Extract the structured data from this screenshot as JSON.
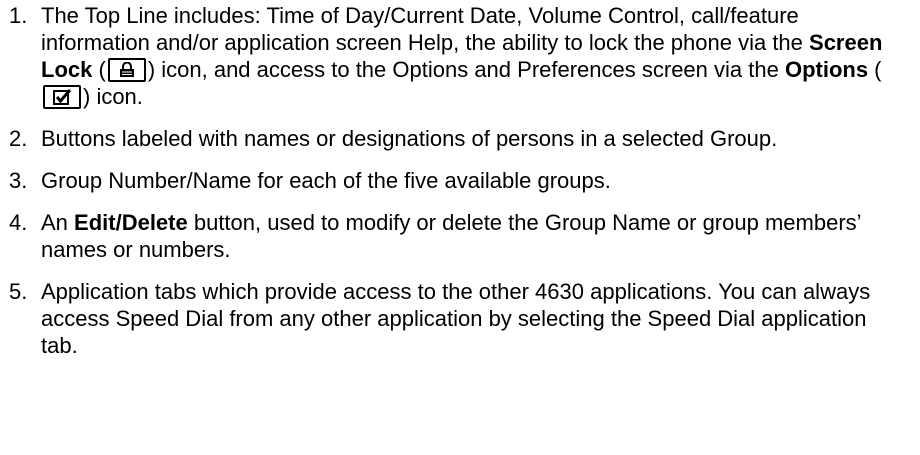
{
  "items": [
    {
      "number": "1.",
      "parts": {
        "a": "The Top Line includes: Time of Day/Current Date, Volume Control, call/feature information and/or application screen Help, the ability to lock the phone via the ",
        "b_bold": "Screen Lock",
        "c": " (",
        "d": ") icon, and access to the Options and Preferences screen via the ",
        "e_bold": "Options",
        "f": " (",
        "g": ") icon."
      },
      "icons": [
        "lock-icon",
        "checkbox-icon"
      ]
    },
    {
      "number": "2.",
      "text": "Buttons labeled with names or designations of persons in a selected Group."
    },
    {
      "number": "3.",
      "text": "Group Number/Name for each of the five available groups."
    },
    {
      "number": "4.",
      "parts": {
        "a": "An ",
        "b_bold": "Edit/Delete",
        "c": " button, used to modify or delete the Group Name or group members’ names or numbers."
      }
    },
    {
      "number": "5.",
      "text": "Application tabs which provide access to the other 4630 applications. You can always access Speed Dial from any other application by selecting the Speed Dial application tab."
    }
  ]
}
